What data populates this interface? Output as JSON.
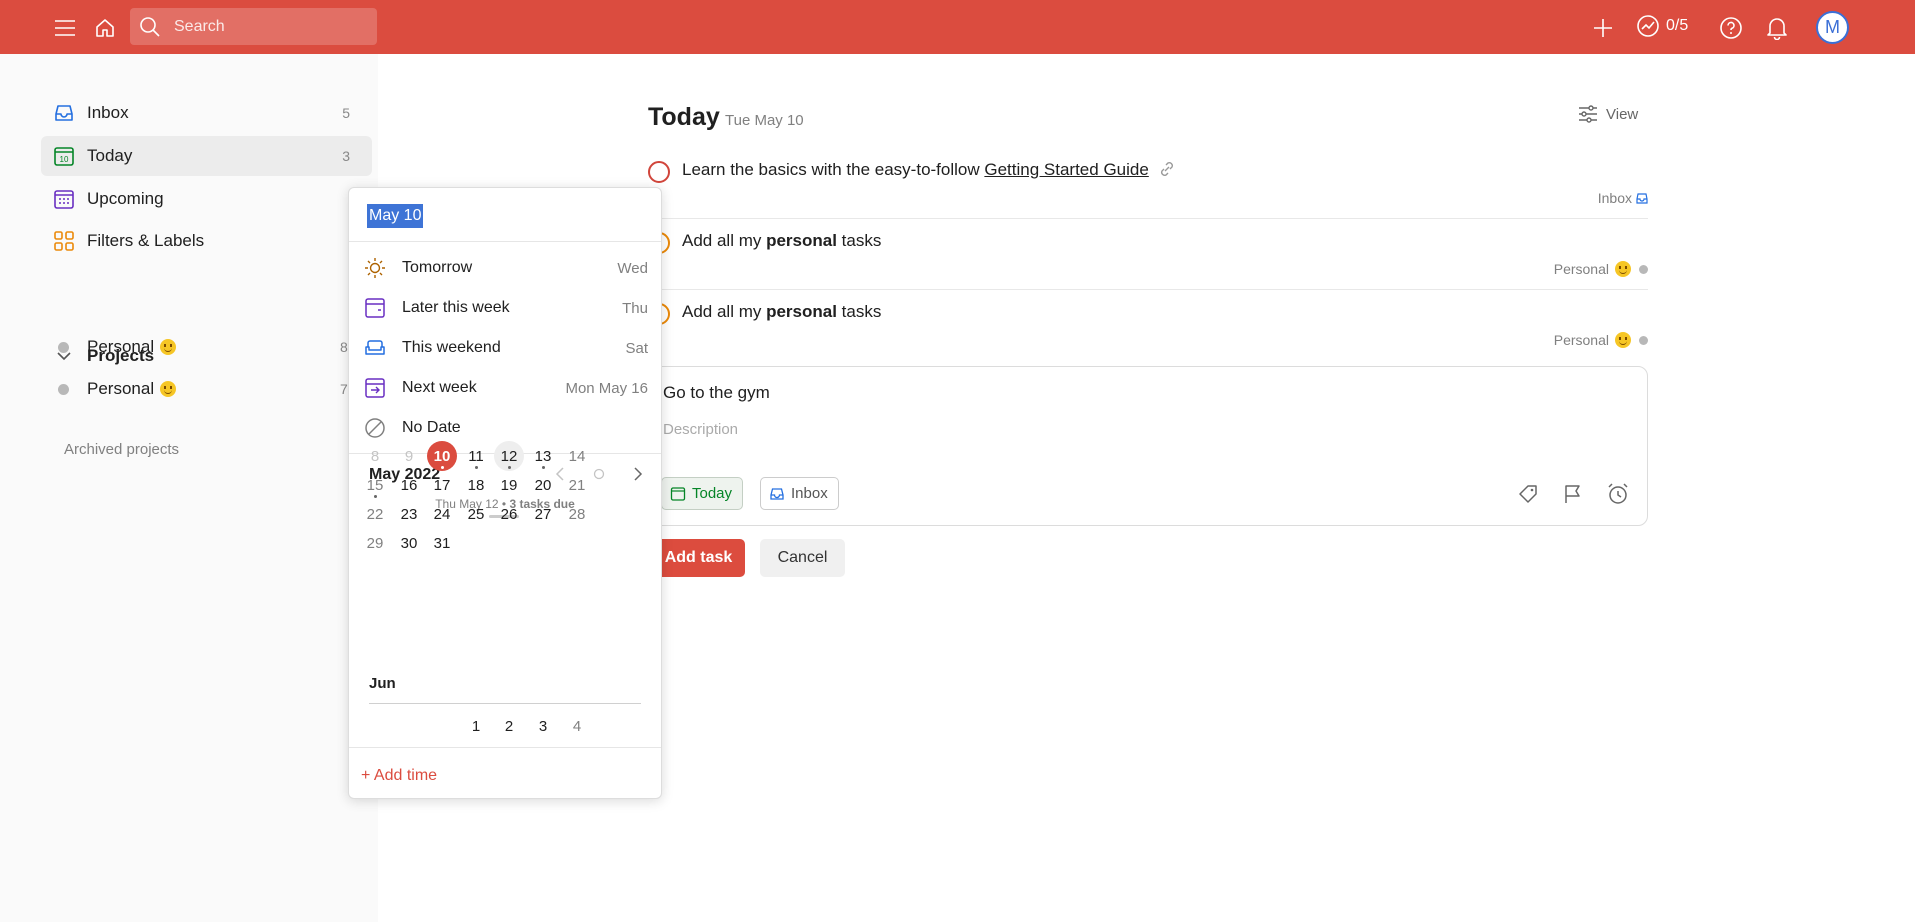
{
  "topbar": {
    "search_placeholder": "Search",
    "karma": "0/5",
    "avatar_initial": "M",
    "accent_color": "#db4c3f"
  },
  "sidebar": {
    "items": [
      {
        "label": "Inbox",
        "count": "5",
        "icon": "inbox-icon"
      },
      {
        "label": "Today",
        "count": "3",
        "icon": "calendar-today-icon"
      },
      {
        "label": "Upcoming",
        "count": "",
        "icon": "calendar-grid-icon"
      },
      {
        "label": "Filters & Labels",
        "count": "",
        "icon": "filters-icon"
      }
    ],
    "projects_title": "Projects",
    "projects": [
      {
        "name": "Personal",
        "count": "8"
      },
      {
        "name": "Personal",
        "count": "7"
      }
    ],
    "archived": "Archived projects"
  },
  "main": {
    "title": "Today",
    "date": "Tue May 10",
    "view_label": "View",
    "tasks": [
      {
        "text_prefix": "Learn the basics with the easy-to-follow ",
        "link": "Getting Started Guide",
        "project": "Inbox"
      },
      {
        "text_prefix": "Add all my ",
        "bold": "personal",
        "text_suffix": " tasks",
        "project": "Personal"
      },
      {
        "text_prefix": "Add all my ",
        "bold": "personal",
        "text_suffix": " tasks",
        "project": "Personal"
      }
    ],
    "editor": {
      "task_name": "Go to the gym",
      "description_placeholder": "Description",
      "due_chip": "Today",
      "project_chip": "Inbox"
    },
    "add_task_label": "Add task",
    "cancel_label": "Cancel"
  },
  "date_picker": {
    "input_value": "May 10",
    "suggestions": [
      {
        "label": "Tomorrow",
        "day": "Wed"
      },
      {
        "label": "Later this week",
        "day": "Thu"
      },
      {
        "label": "This weekend",
        "day": "Sat"
      },
      {
        "label": "Next week",
        "day": "Mon May 16"
      },
      {
        "label": "No Date",
        "day": ""
      }
    ],
    "month_label": "May 2022",
    "hint_date": "Thu May 12",
    "hint_tasks": "3 tasks due",
    "next_month_label": "Jun",
    "add_time_label": "+ Add time",
    "selected_day": "10"
  }
}
